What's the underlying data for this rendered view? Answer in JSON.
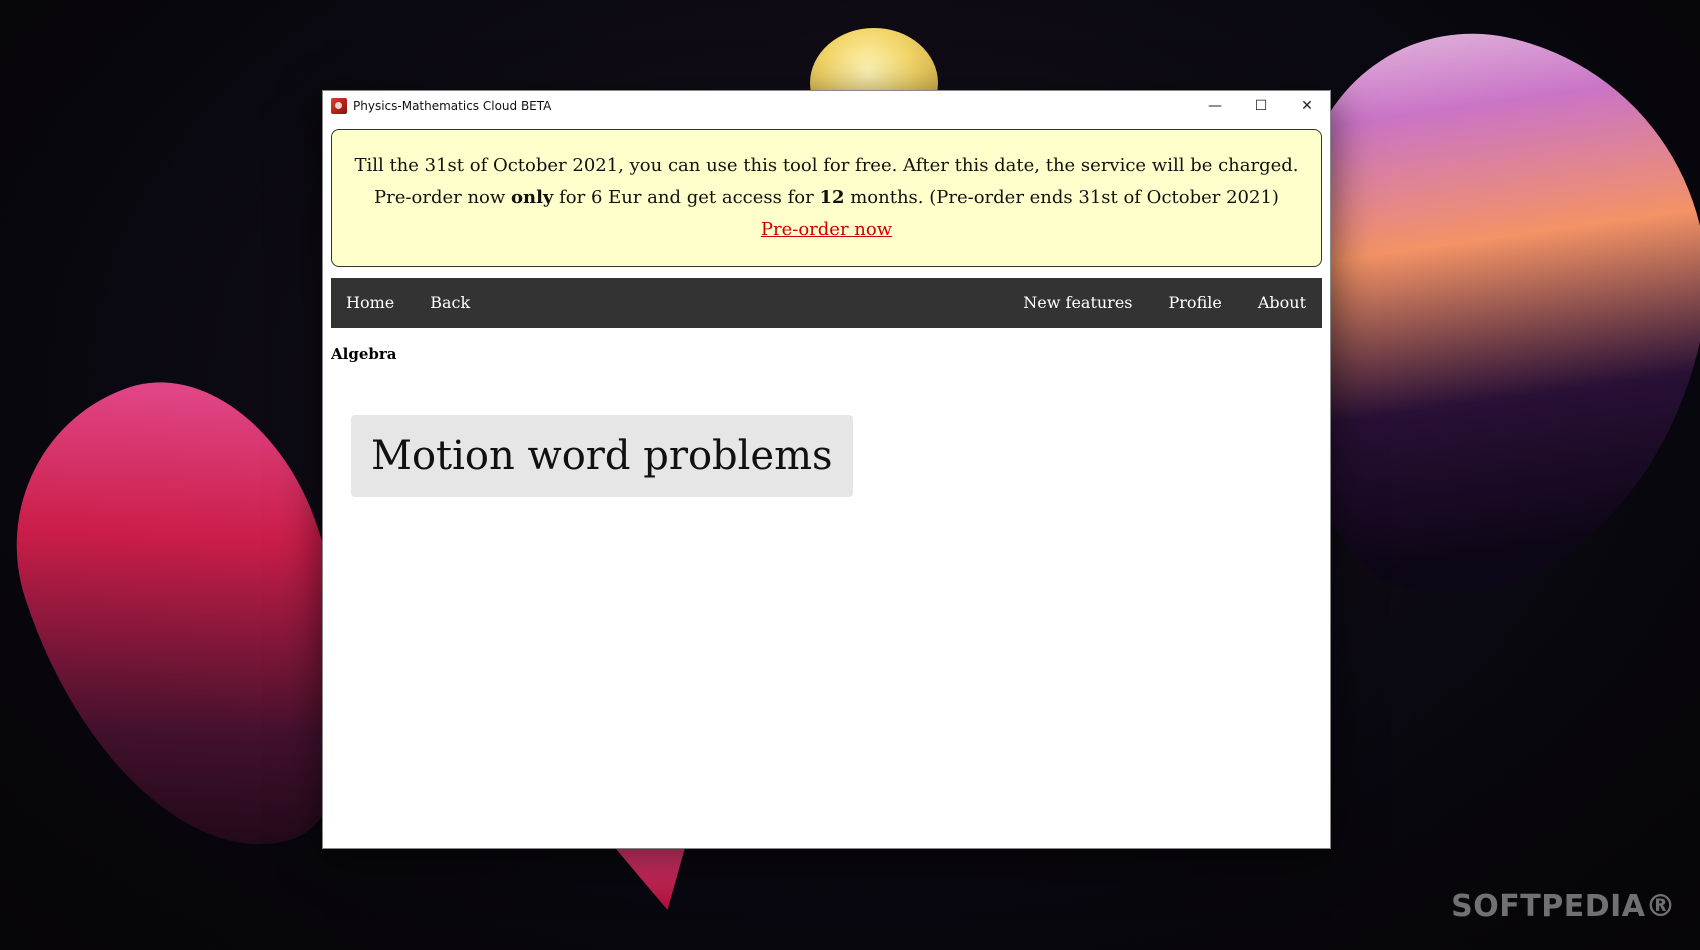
{
  "window": {
    "title": "Physics-Mathematics Cloud BETA",
    "minimize_glyph": "—",
    "maximize_glyph": "☐",
    "close_glyph": "✕"
  },
  "banner": {
    "line1": "Till the 31st of October 2021, you can use this tool for free. After this date, the service will be charged.",
    "line2_pre": "Pre-order now ",
    "line2_bold1": "only",
    "line2_mid": " for 6 Eur and get access for ",
    "line2_bold2": "12",
    "line2_post": " months. (Pre-order ends 31st of October 2021)",
    "link_label": "Pre-order now",
    "background": "#ffffcc",
    "link_color": "#cc0000"
  },
  "nav": {
    "left": [
      "Home",
      "Back"
    ],
    "right": [
      "New features",
      "Profile",
      "About"
    ],
    "background": "#333333"
  },
  "main": {
    "section_title": "Algebra",
    "topics": [
      "Motion word problems"
    ]
  },
  "watermark": "SOFTPEDIA®"
}
